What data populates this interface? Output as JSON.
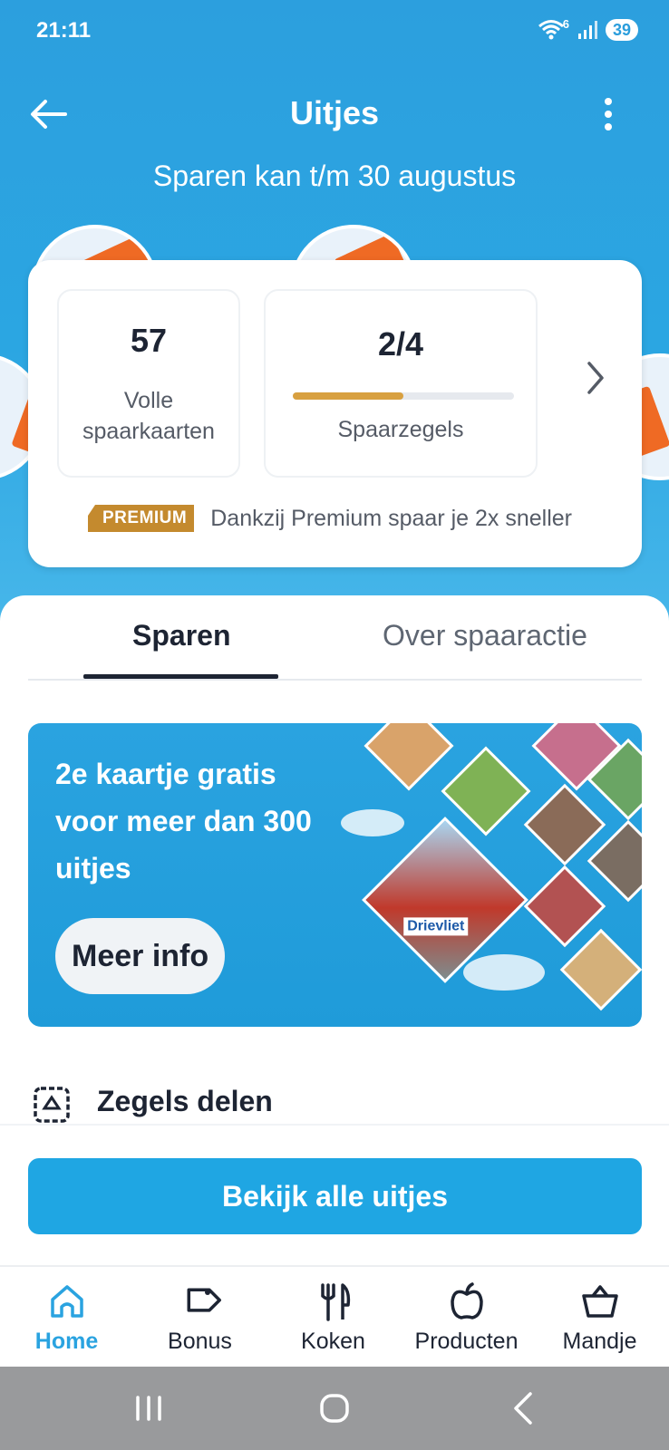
{
  "status": {
    "time": "21:11",
    "wifi_label": "6",
    "battery": "39"
  },
  "header": {
    "title": "Uitjes",
    "subtitle": "Sparen kan t/m 30 augustus"
  },
  "savings_card": {
    "full_cards_value": "57",
    "full_cards_label_1": "Volle",
    "full_cards_label_2": "spaarkaarten",
    "stamps_value": "2/4",
    "stamps_progress": 0.5,
    "stamps_label": "Spaarzegels",
    "premium_badge": "PREMIUM",
    "premium_text": "Dankzij Premium spaar je 2x sneller"
  },
  "tabs": [
    {
      "label": "Sparen",
      "active": true
    },
    {
      "label": "Over spaaractie",
      "active": false
    }
  ],
  "promo": {
    "text": "2e kaartje gratis voor meer dan 300 uitjes",
    "button_label": "Meer info",
    "image_text": "Drievliet"
  },
  "section": {
    "zegels_label": "Zegels delen"
  },
  "cta": {
    "label": "Bekijk alle uitjes"
  },
  "bottom_nav": [
    {
      "label": "Home",
      "icon": "home-icon",
      "active": true
    },
    {
      "label": "Bonus",
      "icon": "tag-icon",
      "active": false
    },
    {
      "label": "Koken",
      "icon": "cutlery-icon",
      "active": false
    },
    {
      "label": "Producten",
      "icon": "apple-icon",
      "active": false
    },
    {
      "label": "Mandje",
      "icon": "basket-icon",
      "active": false
    }
  ],
  "colors": {
    "brand_blue": "#2aa3e0",
    "cta_blue": "#1fa6e3",
    "premium_gold": "#c48a2e",
    "progress_gold": "#d8a040"
  }
}
